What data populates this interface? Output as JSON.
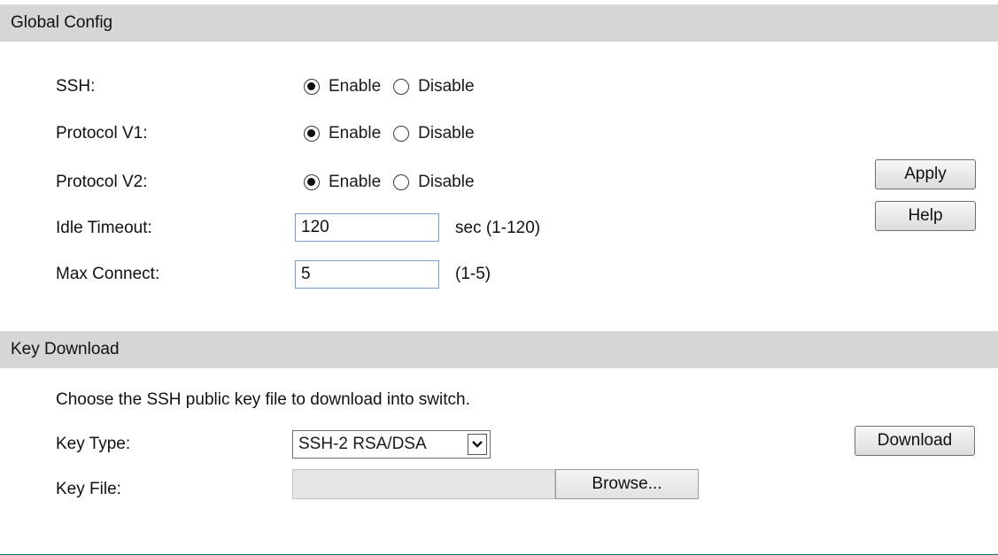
{
  "global_config": {
    "header": "Global Config",
    "ssh": {
      "label": "SSH:",
      "selected": "Enable"
    },
    "protocol_v1": {
      "label": "Protocol V1:",
      "selected": "Enable"
    },
    "protocol_v2": {
      "label": "Protocol V2:",
      "selected": "Enable"
    },
    "enable_label": "Enable",
    "disable_label": "Disable",
    "idle_timeout": {
      "label": "Idle Timeout:",
      "value": "120",
      "hint": "sec (1-120)"
    },
    "max_connect": {
      "label": "Max Connect:",
      "value": "5",
      "hint": "(1-5)"
    },
    "apply_label": "Apply",
    "help_label": "Help"
  },
  "key_download": {
    "header": "Key Download",
    "description": "Choose the SSH public key file to download into switch.",
    "key_type": {
      "label": "Key Type:",
      "selected": "SSH-2 RSA/DSA"
    },
    "key_file": {
      "label": "Key File:",
      "value": ""
    },
    "browse_label": "Browse...",
    "download_label": "Download"
  }
}
